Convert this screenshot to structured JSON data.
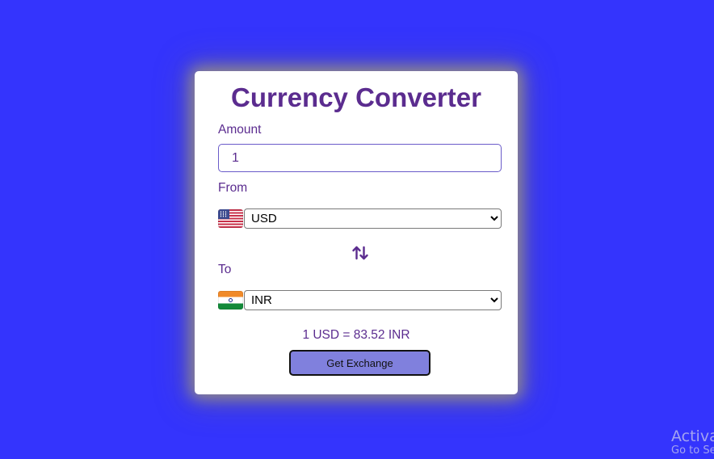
{
  "app": {
    "title": "Currency Converter"
  },
  "amount": {
    "label": "Amount",
    "value": "1"
  },
  "from": {
    "label": "From",
    "currency": "USD",
    "flag_icon": "us-flag-icon"
  },
  "swap": {
    "icon": "swap-arrows-icon"
  },
  "to": {
    "label": "To",
    "currency": "INR",
    "flag_icon": "india-flag-icon"
  },
  "result": {
    "text": "1 USD = 83.52 INR"
  },
  "actions": {
    "get_exchange_label": "Get Exchange"
  },
  "watermark": {
    "line1": "Activa",
    "line2": "Go to Se"
  },
  "colors": {
    "background": "#3434fd",
    "accent": "#5b2c8f",
    "button": "#8080dd"
  }
}
